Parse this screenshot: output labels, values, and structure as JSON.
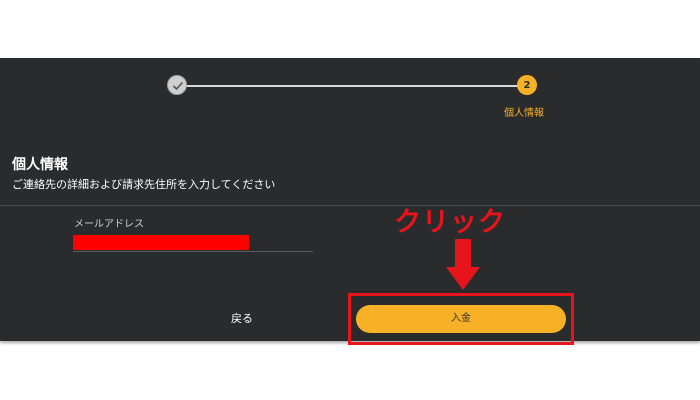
{
  "stepper": {
    "step1_status": "completed",
    "step2_number": "2",
    "step2_label": "個人情報"
  },
  "section": {
    "title": "個人情報",
    "subtitle": "ご連絡先の詳細および請求先住所を入力してください"
  },
  "form": {
    "email_label": "メールアドレス",
    "email_value_redacted": true
  },
  "actions": {
    "back_label": "戻る",
    "deposit_label": "入金"
  },
  "annotation": {
    "text": "クリック"
  },
  "colors": {
    "panel_bg": "#2a2b2d",
    "accent": "#f7b126",
    "annotation_red": "#e8141c",
    "redaction": "#ff0000"
  },
  "icons": {
    "step1": "check-icon",
    "annotation_arrow": "arrow-down-icon"
  }
}
